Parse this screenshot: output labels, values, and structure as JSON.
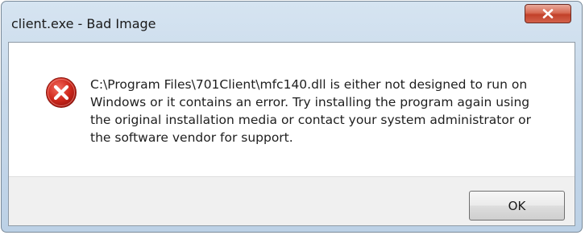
{
  "window": {
    "title": "client.exe - Bad Image"
  },
  "message": {
    "text": "C:\\Program Files\\701Client\\mfc140.dll is either not designed to run on Windows or it contains an error. Try installing the program again using the original installation media or contact your system administrator or the software vendor for support."
  },
  "buttons": {
    "ok_label": "OK"
  },
  "icons": {
    "title_close": "close-icon",
    "message": "error-icon"
  },
  "colors": {
    "error_red": "#c8281e",
    "close_button_red": "#c94a35"
  }
}
